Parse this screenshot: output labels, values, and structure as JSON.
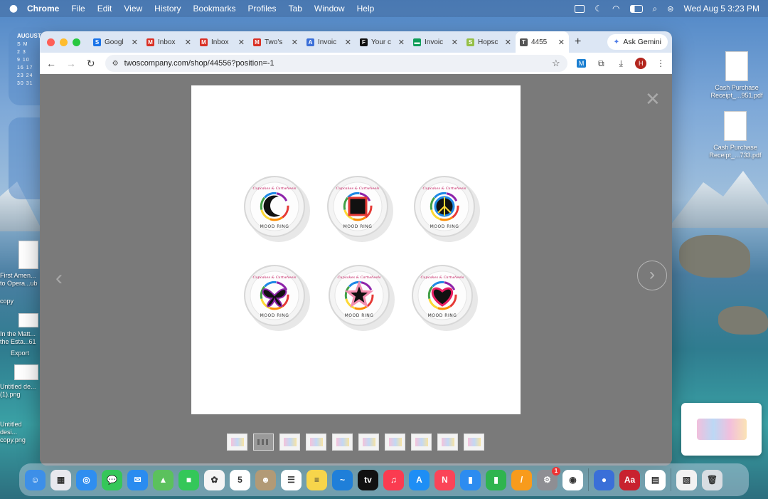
{
  "menubar": {
    "app_name": "Chrome",
    "items": [
      "File",
      "Edit",
      "View",
      "History",
      "Bookmarks",
      "Profiles",
      "Tab",
      "Window",
      "Help"
    ],
    "clock": "Wed Aug 5  3:23 PM"
  },
  "calendar_widget": {
    "month": "AUGUST",
    "header": "S  M",
    "rows": [
      "2  3",
      "9  10",
      "16  17",
      "23  24",
      "30  31"
    ]
  },
  "desktop_icons_right": [
    {
      "label": "Cash Purchase Receipt_...951.pdf"
    },
    {
      "label": "Cash Purchase Receipt_...733.pdf"
    }
  ],
  "desktop_icons_left": [
    {
      "label": "First Amen... to Opera...ub"
    },
    {
      "label": "copy"
    },
    {
      "label": "In the Matt... the Esta...61"
    },
    {
      "label": "Export"
    },
    {
      "label": "Untitled de... (1).png"
    },
    {
      "label": "Untitled desi... copy.png"
    }
  ],
  "browser": {
    "tabs": [
      {
        "label": "Googl",
        "icon": "google-sheets-icon",
        "color": "#1a73e8",
        "glyph": "S"
      },
      {
        "label": "Inbox",
        "icon": "gmail-icon",
        "color": "#d93025",
        "glyph": "M"
      },
      {
        "label": "Inbox",
        "icon": "gmail-icon",
        "color": "#d93025",
        "glyph": "M"
      },
      {
        "label": "Two's",
        "icon": "gmail-icon",
        "color": "#d93025",
        "glyph": "M"
      },
      {
        "label": "Invoic",
        "icon": "invoice-app-icon",
        "color": "#3b6fd8",
        "glyph": "A"
      },
      {
        "label": "Your c",
        "icon": "faire-icon",
        "color": "#111111",
        "glyph": "F"
      },
      {
        "label": "Invoic",
        "icon": "invoice-green-icon",
        "color": "#0f9d58",
        "glyph": "▬"
      },
      {
        "label": "Hopsc",
        "icon": "shopify-icon",
        "color": "#95bf47",
        "glyph": "S"
      },
      {
        "label": "4455",
        "icon": "twos-company-icon",
        "color": "#555555",
        "glyph": "T"
      }
    ],
    "new_tab": "+",
    "gemini_label": "Ask Gemini",
    "url": "twoscompany.com/shop/44556?position=-1",
    "profile_initial": "H"
  },
  "product": {
    "brand_text": "Cupcakes & Cartwheels",
    "ring_label": "MOOD RING",
    "rings": [
      {
        "shape": "moon",
        "name": "moon-ring"
      },
      {
        "shape": "square",
        "name": "square-ring"
      },
      {
        "shape": "peace",
        "name": "peace-ring"
      },
      {
        "shape": "butterfly",
        "name": "butterfly-ring"
      },
      {
        "shape": "star",
        "name": "star-ring"
      },
      {
        "shape": "heart",
        "name": "heart-ring"
      }
    ],
    "thumbnail_count": 10,
    "selected_thumbnail": 1
  },
  "dock": {
    "apps": [
      {
        "name": "finder-icon",
        "color": "#3d8fe8",
        "glyph": "☺"
      },
      {
        "name": "launchpad-icon",
        "color": "#e8e8ee",
        "glyph": "▦"
      },
      {
        "name": "safari-icon",
        "color": "#2f8ef0",
        "glyph": "◎"
      },
      {
        "name": "messages-icon",
        "color": "#35c759",
        "glyph": "💬"
      },
      {
        "name": "mail-icon",
        "color": "#2a8cf0",
        "glyph": "✉"
      },
      {
        "name": "maps-icon",
        "color": "#5bc15d",
        "glyph": "▲"
      },
      {
        "name": "facetime-icon",
        "color": "#34c759",
        "glyph": "■"
      },
      {
        "name": "photos-icon",
        "color": "#f5f5f5",
        "glyph": "✿"
      },
      {
        "name": "calendar-icon",
        "color": "#ffffff",
        "glyph": "5"
      },
      {
        "name": "contacts-icon",
        "color": "#b29a76",
        "glyph": "☻"
      },
      {
        "name": "reminders-icon",
        "color": "#ffffff",
        "glyph": "☰"
      },
      {
        "name": "notes-icon",
        "color": "#f7d54b",
        "glyph": "≡"
      },
      {
        "name": "freeform-icon",
        "color": "#1f7fd9",
        "glyph": "~"
      },
      {
        "name": "apple-tv-icon",
        "color": "#111111",
        "glyph": "tv"
      },
      {
        "name": "music-icon",
        "color": "#fb3b50",
        "glyph": "♫"
      },
      {
        "name": "app-store-icon",
        "color": "#1e8ef5",
        "glyph": "A"
      },
      {
        "name": "news-icon",
        "color": "#fb4458",
        "glyph": "N"
      },
      {
        "name": "keynote-icon",
        "color": "#2d8cf0",
        "glyph": "▮"
      },
      {
        "name": "numbers-icon",
        "color": "#2fb44f",
        "glyph": "▮"
      },
      {
        "name": "pages-icon",
        "color": "#f89b1c",
        "glyph": "/"
      },
      {
        "name": "system-settings-icon",
        "color": "#8e8e93",
        "glyph": "⚙",
        "badge": "1"
      },
      {
        "name": "chrome-icon",
        "color": "#ffffff",
        "glyph": "◉"
      },
      {
        "name": "screen-capture-icon",
        "color": "#3a6fd8",
        "glyph": "●"
      },
      {
        "name": "dictionary-icon",
        "color": "#c8222f",
        "glyph": "Aa"
      },
      {
        "name": "spreadsheet-icon",
        "color": "#ffffff",
        "glyph": "▤"
      },
      {
        "name": "preview-document-icon",
        "color": "#f2f2f2",
        "glyph": "▧"
      },
      {
        "name": "trash-icon",
        "color": "#d9dde2",
        "glyph": "🗑"
      }
    ]
  }
}
